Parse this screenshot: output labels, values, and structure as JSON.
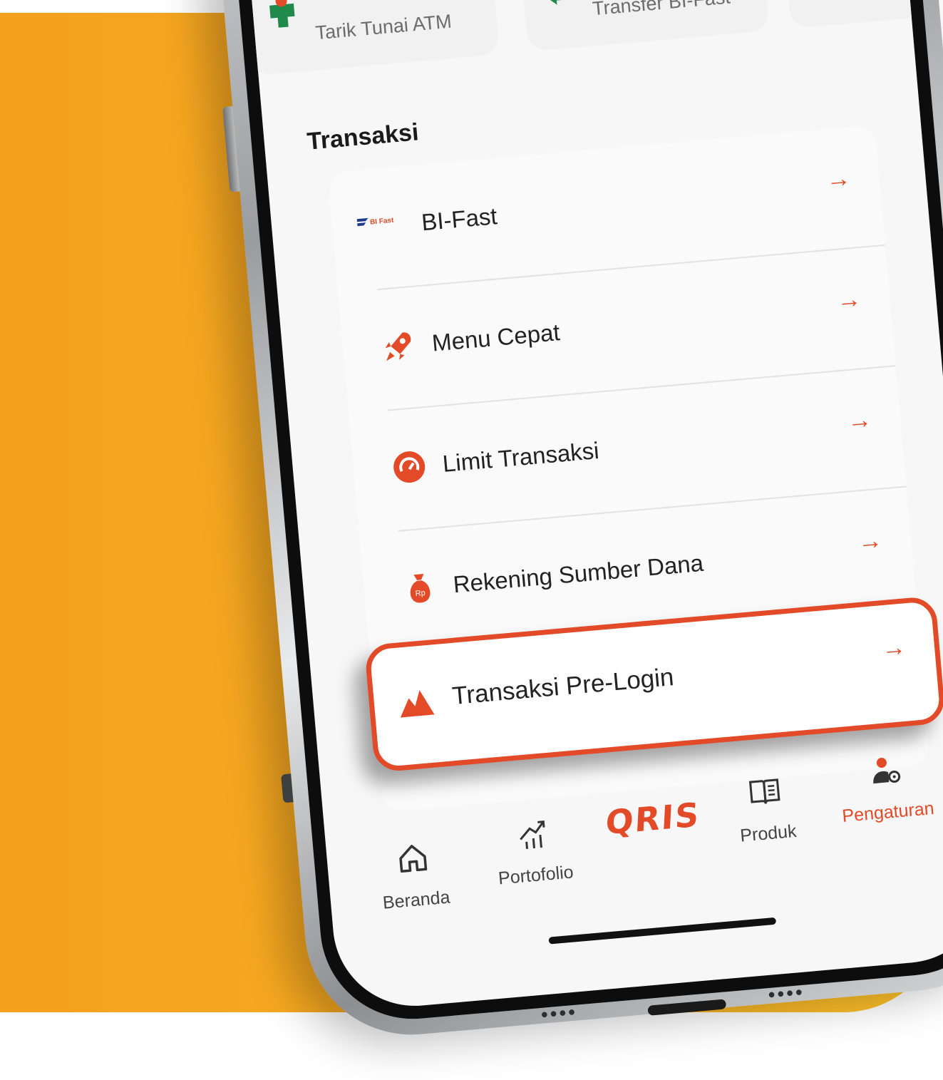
{
  "colors": {
    "accent": "#e24a28",
    "background": "#f7ad22",
    "screen": "#f7f7f7"
  },
  "quick_actions": [
    {
      "icon": "atm-cash-icon",
      "label": "Tarik Tunai ATM"
    },
    {
      "icon": "transfer-arrows-icon",
      "label": "Transfer BI-Fast"
    }
  ],
  "section_title": "Transaksi",
  "menu_items": [
    {
      "icon": "bi-fast-logo-icon",
      "label": "BI-Fast"
    },
    {
      "icon": "rocket-icon",
      "label": "Menu Cepat"
    },
    {
      "icon": "speedometer-icon",
      "label": "Limit Transaksi"
    },
    {
      "icon": "money-bag-icon",
      "label": "Rekening Sumber Dana",
      "icon_text": "Rp"
    }
  ],
  "highlighted_item": {
    "icon": "mountain-icon",
    "label": "Transaksi Pre-Login"
  },
  "arrow": "→",
  "bi_fast_logo_text": "BI Fast",
  "nav": [
    {
      "icon": "home-icon",
      "label": "Beranda",
      "active": false
    },
    {
      "icon": "chart-growth-icon",
      "label": "Portofolio",
      "active": false
    },
    {
      "icon": "qris-icon",
      "label": "QRIS",
      "active": false
    },
    {
      "icon": "book-icon",
      "label": "Produk",
      "active": false
    },
    {
      "icon": "user-settings-icon",
      "label": "Pengaturan",
      "active": true
    }
  ]
}
